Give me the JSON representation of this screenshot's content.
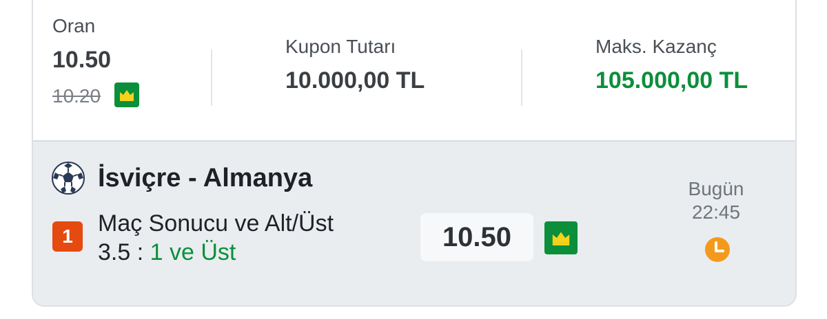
{
  "summary": {
    "odds_label": "Oran",
    "odds_value": "10.50",
    "odds_old": "10.20",
    "stake_label": "Kupon Tutarı",
    "stake_value": "10.000,00 TL",
    "max_win_label": "Maks. Kazanç",
    "max_win_value": "105.000,00 TL"
  },
  "event": {
    "icon": "soccer-ball-icon",
    "title": "İsviçre - Almanya",
    "selection_number": "1",
    "market_line1": "Maç Sonucu ve Alt/Üst",
    "market_line2_prefix": "3.5 : ",
    "market_pick": "1 ve Üst",
    "odd": "10.50",
    "date": "Bugün",
    "time": "22:45",
    "clock_icon": "clock-icon",
    "crown_icon": "crown-icon"
  },
  "colors": {
    "green": "#0c8f3a",
    "orange": "#e54a10",
    "clock": "#f39a1c"
  }
}
